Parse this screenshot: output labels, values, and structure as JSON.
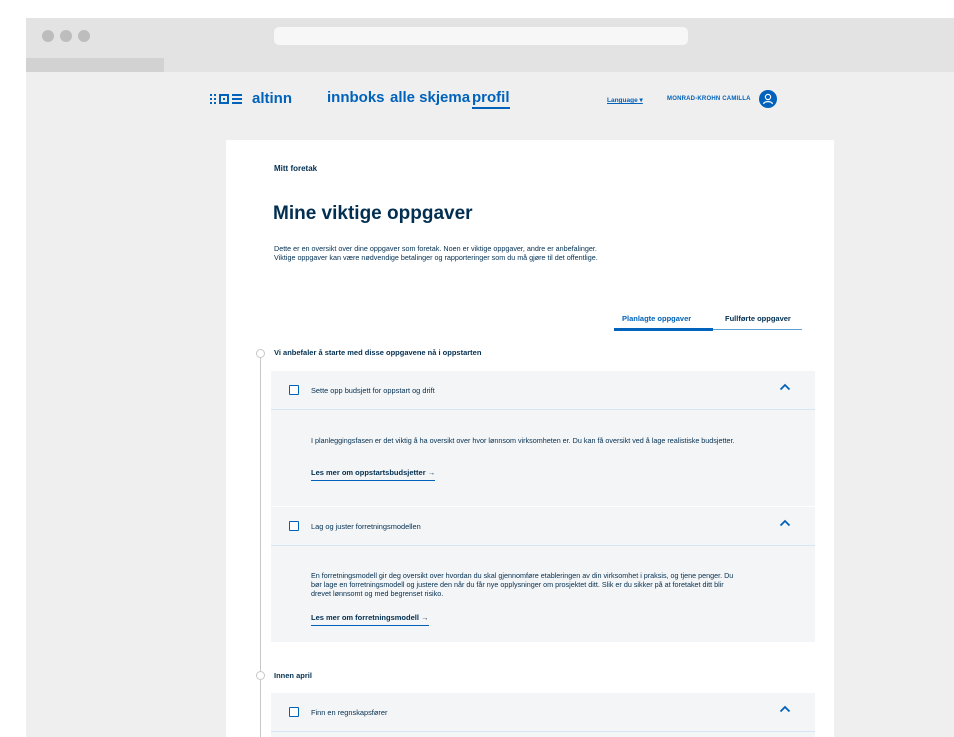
{
  "nav": {
    "logo_text": "altinn",
    "links": [
      "innboks",
      "alle skjema",
      "profil"
    ],
    "language": "Language",
    "user": "MONRAD-KROHN CAMILLA"
  },
  "page": {
    "eyebrow": "Mitt foretak",
    "title": "Mine viktige oppgaver",
    "lead": "Dette er en oversikt over dine oppgaver som foretak. Noen er viktige oppgaver, andre er anbefalinger. Viktige oppgaver kan være nødvendige betalinger og rapporteringer som du må gjøre til det offentlige."
  },
  "tabs": [
    "Planlagte oppgaver",
    "Fullførte oppgaver"
  ],
  "groups": [
    {
      "title": "Vi anbefaler å starte med disse oppgavene nå i oppstarten",
      "tasks": [
        {
          "title": "Sette opp budsjett for oppstart og drift",
          "text": "I planleggingsfasen er det viktig å ha oversikt over hvor lønnsom virksomheten er. Du kan få oversikt ved å lage realistiske budsjetter.",
          "link": "Les mer om oppstartsbudsjetter →"
        },
        {
          "title": "Lag og juster forretningsmodellen",
          "text": "En forretningsmodell gir deg oversikt over hvordan du skal gjennomføre etableringen av din virksomhet i praksis, og tjene penger. Du bør lage en forretningsmodell og justere den når du får nye opplysninger om prosjektet ditt. Slik er du sikker på at foretaket ditt blir drevet lønnsomt og med begrenset risiko.",
          "link": "Les mer om forretningsmodell →"
        }
      ]
    },
    {
      "title": "Innen april",
      "tasks": [
        {
          "title": "Finn en regnskapsfører"
        }
      ]
    }
  ],
  "colors": {
    "brand": "#0062ba",
    "text": "#022f51",
    "task_bg": "#f4f5f6",
    "page_bg": "#efefef"
  }
}
